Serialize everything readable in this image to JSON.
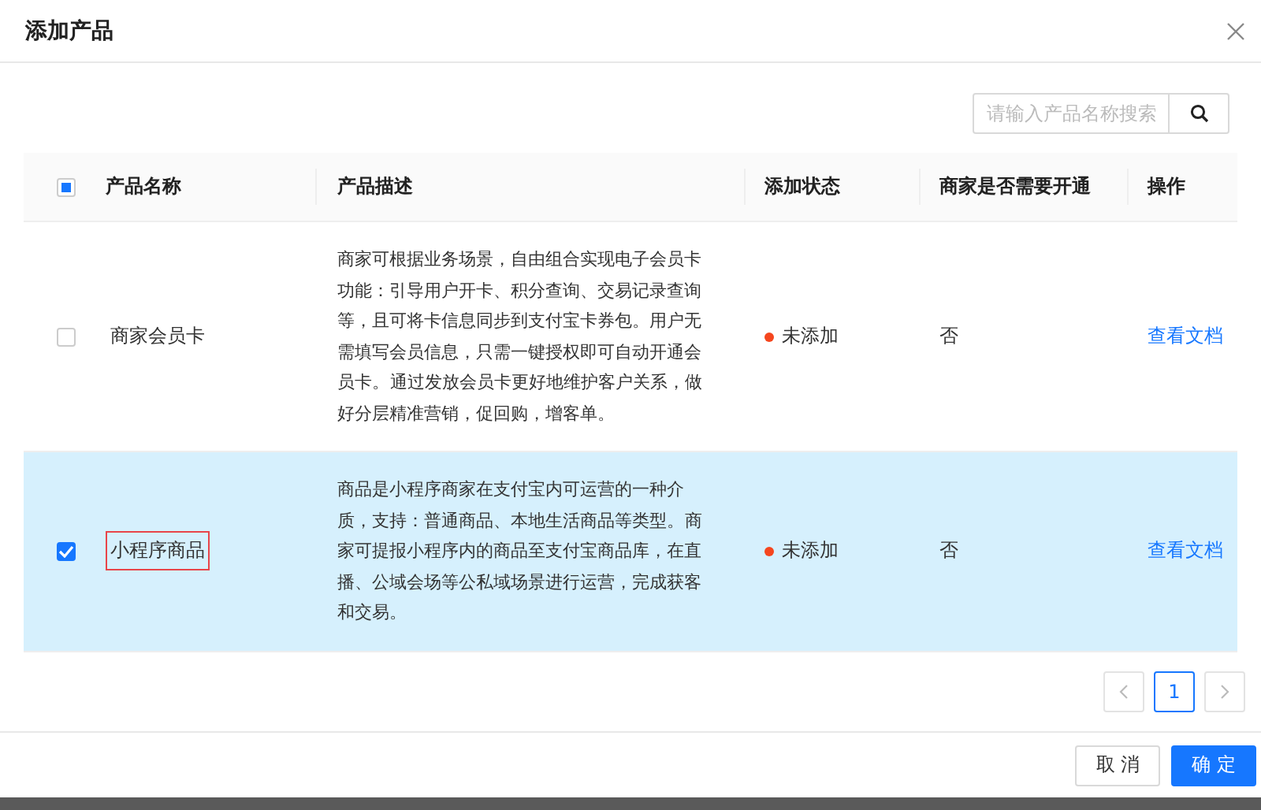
{
  "dialog": {
    "title": "添加产品"
  },
  "search": {
    "placeholder": "请输入产品名称搜索"
  },
  "table": {
    "select_all": {
      "indeterminate": true
    },
    "columns": [
      "产品名称",
      "产品描述",
      "添加状态",
      "商家是否需要开通",
      "操作"
    ],
    "rows": [
      {
        "selected": false,
        "name": "商家会员卡",
        "name_outlined": false,
        "description": "商家可根据业务场景，自由组合实现电子会员卡功能：引导用户开卡、积分查询、交易记录查询等，且可将卡信息同步到支付宝卡券包。用户无需填写会员信息，只需一键授权即可自动开通会员卡。 通过发放会员卡更好地维护客户关系，做好分层精准营销，促回购，增客单。",
        "status": "未添加",
        "color": "#f5461e",
        "needs_activation": "否",
        "action": "查看文档"
      },
      {
        "selected": true,
        "name": "小程序商品",
        "name_outlined": true,
        "description": "商品是小程序商家在支付宝内可运营的一种介质，支持：普通商品、本地生活商品等类型。 商家可提报小程序内的商品至支付宝商品库，在直播、公域会场等公私域场景进行运营，完成获客和交易。",
        "status": "未添加",
        "color": "#f5461e",
        "needs_activation": "否",
        "action": "查看文档"
      }
    ]
  },
  "pagination": {
    "pages": [
      {
        "label": "1",
        "selected": true
      }
    ]
  },
  "footer": {
    "buttons": [
      {
        "label": "取 消",
        "kind": "default"
      },
      {
        "label": "确 定",
        "kind": "primary"
      }
    ]
  }
}
